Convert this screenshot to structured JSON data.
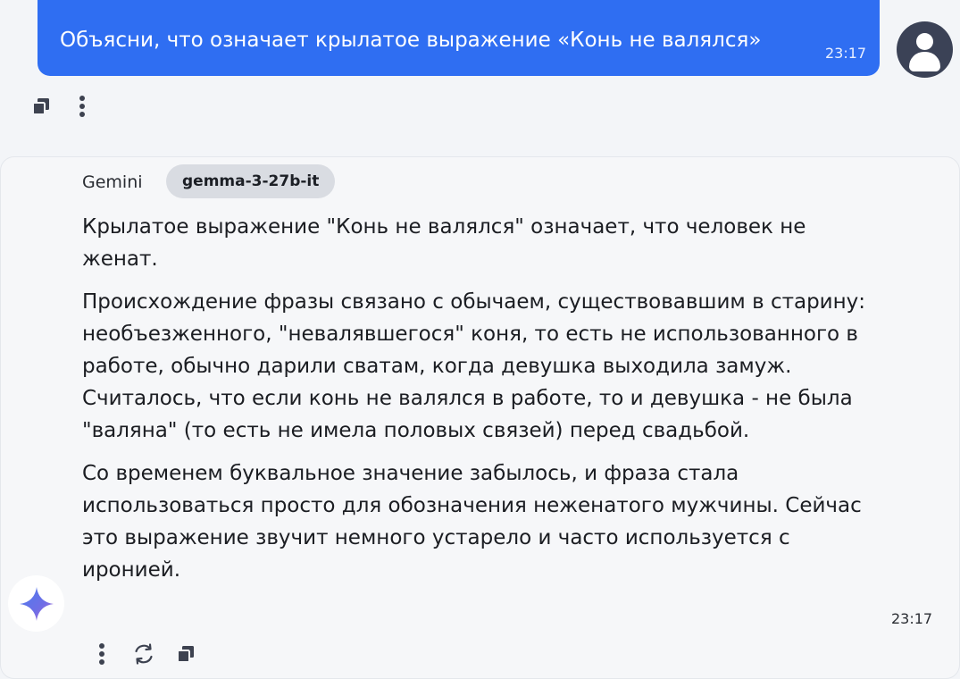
{
  "user_message": {
    "text": "Объясни, что означает крылатое выражение «Конь не валялся»",
    "time": "23:17",
    "avatar_icon": "user-avatar-icon",
    "actions": [
      "copy-icon",
      "more-vertical-icon"
    ]
  },
  "assistant_message": {
    "name": "Gemini",
    "model": "gemma-3-27b-it",
    "paragraphs": [
      "Крылатое выражение \"Конь не валялся\" означает, что человек не женат.",
      "Происхождение фразы связано с обычаем, существовавшим в старину: необъезженного, \"невалявшегося\" коня, то есть не использованного в работе, обычно дарили сватам, когда девушка выходила замуж.  Считалось, что если конь не валялся в работе, то и девушка - не была \"валяна\" (то есть не имела половых связей) перед свадьбой.",
      "Со временем буквальное значение забылось, и фраза стала использоваться просто для обозначения неженатого мужчины. Сейчас это выражение звучит немного устарело и часто используется с иронией."
    ],
    "time": "23:17",
    "avatar_icon": "gemini-sparkle-icon",
    "actions": [
      "more-vertical-icon",
      "regenerate-icon",
      "copy-icon"
    ]
  },
  "colors": {
    "background": "#f3f5f8",
    "user_bubble": "#2f6ef2",
    "avatar_dark": "#3b4256",
    "chip": "#d9dce2",
    "icon": "#3d4250",
    "sparkle_blue": "#4a7dee",
    "sparkle_purple": "#9b62d6"
  }
}
